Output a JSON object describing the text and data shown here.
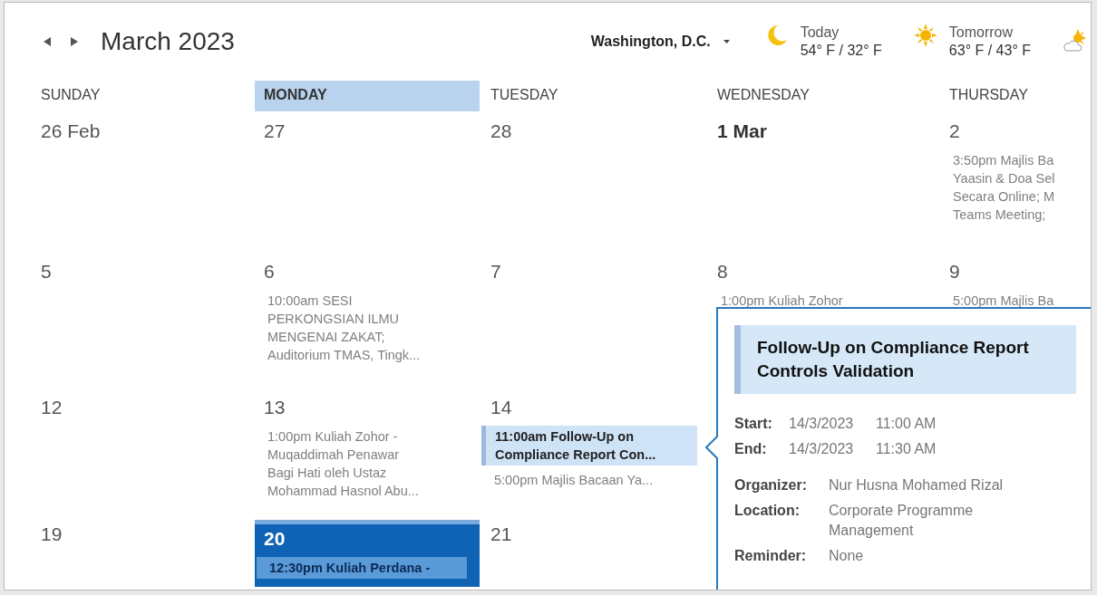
{
  "header": {
    "title": "March 2023",
    "location": "Washington, D.C.",
    "weather": [
      {
        "kind": "moon",
        "label": "Today",
        "temps": "54° F / 32° F"
      },
      {
        "kind": "sun",
        "label": "Tomorrow",
        "temps": "63° F / 43° F"
      },
      {
        "kind": "partly-cloudy"
      }
    ]
  },
  "day_headers": [
    {
      "label": "SUNDAY",
      "selected": false
    },
    {
      "label": "MONDAY",
      "selected": true
    },
    {
      "label": "TUESDAY",
      "selected": false
    },
    {
      "label": "WEDNESDAY",
      "selected": false
    },
    {
      "label": "THURSDAY",
      "selected": false
    }
  ],
  "weeks": [
    {
      "days": [
        {
          "date": "26 Feb",
          "month_start": false,
          "today": false
        },
        {
          "date": "27",
          "month_start": false,
          "today": false
        },
        {
          "date": "28",
          "month_start": false,
          "today": false
        },
        {
          "date": "1 Mar",
          "month_start": true,
          "today": false
        },
        {
          "date": "2",
          "month_start": false,
          "today": false,
          "events": [
            {
              "lines": [
                "3:50pm Majlis Ba",
                "Yaasin & Doa Sel",
                "Secara Online; M",
                "Teams Meeting;"
              ],
              "selected": false
            }
          ]
        }
      ]
    },
    {
      "days": [
        {
          "date": "5",
          "month_start": false,
          "today": false
        },
        {
          "date": "6",
          "month_start": false,
          "today": false,
          "events": [
            {
              "lines": [
                "10:00am SESI",
                "PERKONGSIAN ILMU",
                "MENGENAI ZAKAT;",
                "Auditorium TMAS, Tingk..."
              ],
              "selected": false
            }
          ]
        },
        {
          "date": "7",
          "month_start": false,
          "today": false
        },
        {
          "date": "8",
          "month_start": false,
          "today": false,
          "events": [
            {
              "lines": [
                "1:00pm Kuliah Zohor"
              ],
              "selected": false
            }
          ]
        },
        {
          "date": "9",
          "month_start": false,
          "today": false,
          "events": [
            {
              "lines": [
                "5:00pm Majlis Ba"
              ],
              "selected": false
            }
          ]
        }
      ]
    },
    {
      "days": [
        {
          "date": "12",
          "month_start": false,
          "today": false
        },
        {
          "date": "13",
          "month_start": false,
          "today": false,
          "events": [
            {
              "lines": [
                "1:00pm Kuliah Zohor -",
                "Muqaddimah Penawar",
                "Bagi Hati oleh Ustaz",
                "Mohammad Hasnol Abu..."
              ],
              "selected": false
            }
          ]
        },
        {
          "date": "14",
          "month_start": false,
          "today": false,
          "events": [
            {
              "lines": [
                "11:00am Follow-Up on",
                "Compliance Report Con..."
              ],
              "selected": true
            },
            {
              "lines": [
                "5:00pm Majlis Bacaan Ya..."
              ],
              "selected": false
            }
          ]
        }
      ]
    },
    {
      "days": [
        {
          "date": "19",
          "month_start": false,
          "today": false
        },
        {
          "date": "20",
          "month_start": false,
          "today": true,
          "events": [
            {
              "lines": [
                "12:30pm Kuliah Perdana -"
              ],
              "selected": false
            }
          ]
        },
        {
          "date": "21",
          "month_start": false,
          "today": false
        }
      ]
    }
  ],
  "popup": {
    "title": "Follow-Up on Compliance Report Controls Validation",
    "times": [
      {
        "label": "Start:",
        "date": "14/3/2023",
        "time": "11:00 AM"
      },
      {
        "label": "End:",
        "date": "14/3/2023",
        "time": "11:30 AM"
      }
    ],
    "details": [
      {
        "label": "Organizer:",
        "value": "Nur Husna Mohamed Rizal"
      },
      {
        "label": "Location:",
        "value": "Corporate Programme Management"
      },
      {
        "label": "Reminder:",
        "value": "None"
      }
    ]
  }
}
